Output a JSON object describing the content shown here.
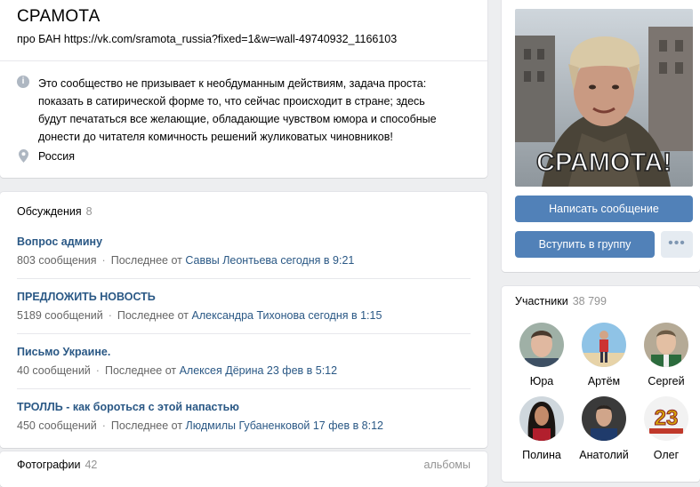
{
  "group": {
    "title": "СРАМОТА",
    "status": "про БАН https://vk.com/sramota_russia?fixed=1&w=wall-49740932_1166103",
    "description_lines": [
      "Это сообщество не призывает к необдуманным действиям, задача проста:",
      "показать в сатирической форме то, что сейчас происходит в стране; здесь",
      "будут печататься все желающие, обладающие чувством юмора и способные",
      "донести до читателя комичность решений жуликоватых чиновников!"
    ],
    "location": "Россия",
    "info_icon": "info-icon",
    "location_icon": "map-pin-icon"
  },
  "discussions": {
    "label": "Обсуждения",
    "count": "8",
    "topics": [
      {
        "title": "Вопрос админу",
        "count": "803 сообщения",
        "prefix": "Последнее от",
        "author": "Саввы Леонтьева сегодня в 9:21"
      },
      {
        "title": "ПРЕДЛОЖИТЬ НОВОСТЬ",
        "count": "5189 сообщений",
        "prefix": "Последнее от",
        "author": "Александра Тихонова сегодня в 1:15"
      },
      {
        "title": "Письмо Украине.",
        "count": "40 сообщений",
        "prefix": "Последнее от",
        "author": "Алексея Дёрина 23 фев в 5:12"
      },
      {
        "title": "ТРОЛЛЬ - как бороться с этой напастью",
        "count": "450 сообщений",
        "prefix": "Последнее от",
        "author": "Людмилы Губаненковой 17 фев в 8:12"
      }
    ]
  },
  "photos": {
    "label": "Фотографии",
    "count": "42",
    "albums": "альбомы"
  },
  "side": {
    "cover_text": "СРАМОТА!",
    "message_button": "Написать сообщение",
    "join_button": "Вступить в группу",
    "more_button": "•••"
  },
  "members": {
    "label": "Участники",
    "count": "38 799",
    "people": [
      {
        "name": "Юра"
      },
      {
        "name": "Артём"
      },
      {
        "name": "Сергей"
      },
      {
        "name": "Полина"
      },
      {
        "name": "Анатолий"
      },
      {
        "name": "Олег"
      }
    ],
    "badge_text": "23"
  },
  "colors": {
    "link": "#2a5885",
    "button": "#5181b8",
    "muted": "#939393",
    "background": "#edeef0"
  }
}
